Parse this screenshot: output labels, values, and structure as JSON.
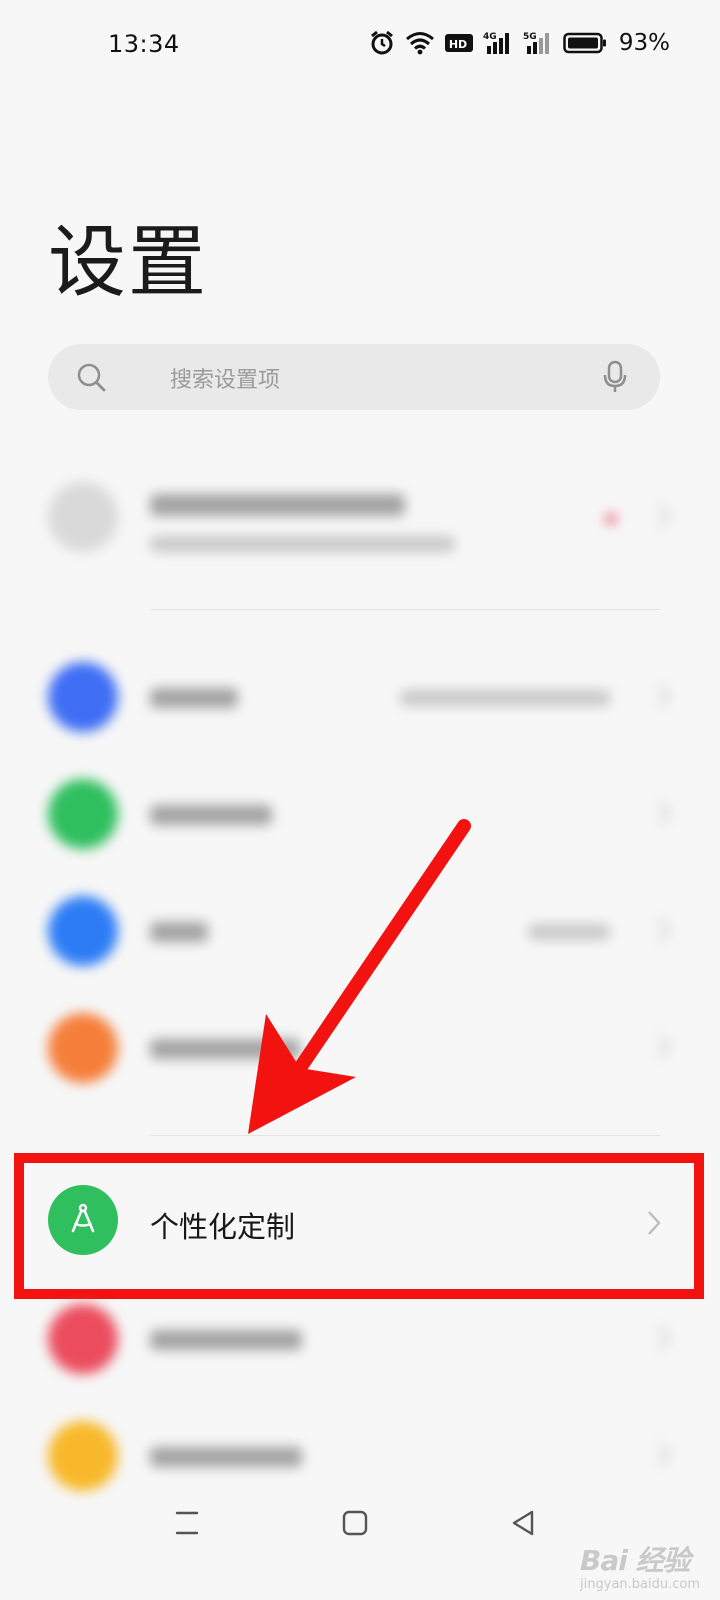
{
  "status_bar": {
    "time": "13:34",
    "battery_percent": "93%",
    "icons": [
      "alarm-icon",
      "wifi-icon",
      "hd-icon",
      "signal-4g-icon",
      "signal-5g-icon",
      "battery-icon"
    ],
    "hd_label": "HD",
    "net1_label": "4G",
    "net2_label": "5G"
  },
  "header": {
    "title": "设置"
  },
  "search": {
    "placeholder": "搜索设置项"
  },
  "rows": {
    "personalization": {
      "label": "个性化定制"
    }
  },
  "colors": {
    "wlan": "#3f6ef5",
    "mobile": "#2fbf5e",
    "bluetooth": "#2d7cf6",
    "connection": "#f57f3a",
    "personalization": "#2fbf5e",
    "desktop": "#eb4d5e",
    "display": "#f7b92b",
    "annotation": "#f2120f"
  },
  "watermark": {
    "logo": "Bai  经验",
    "sub": "jingyan.baidu.com"
  }
}
